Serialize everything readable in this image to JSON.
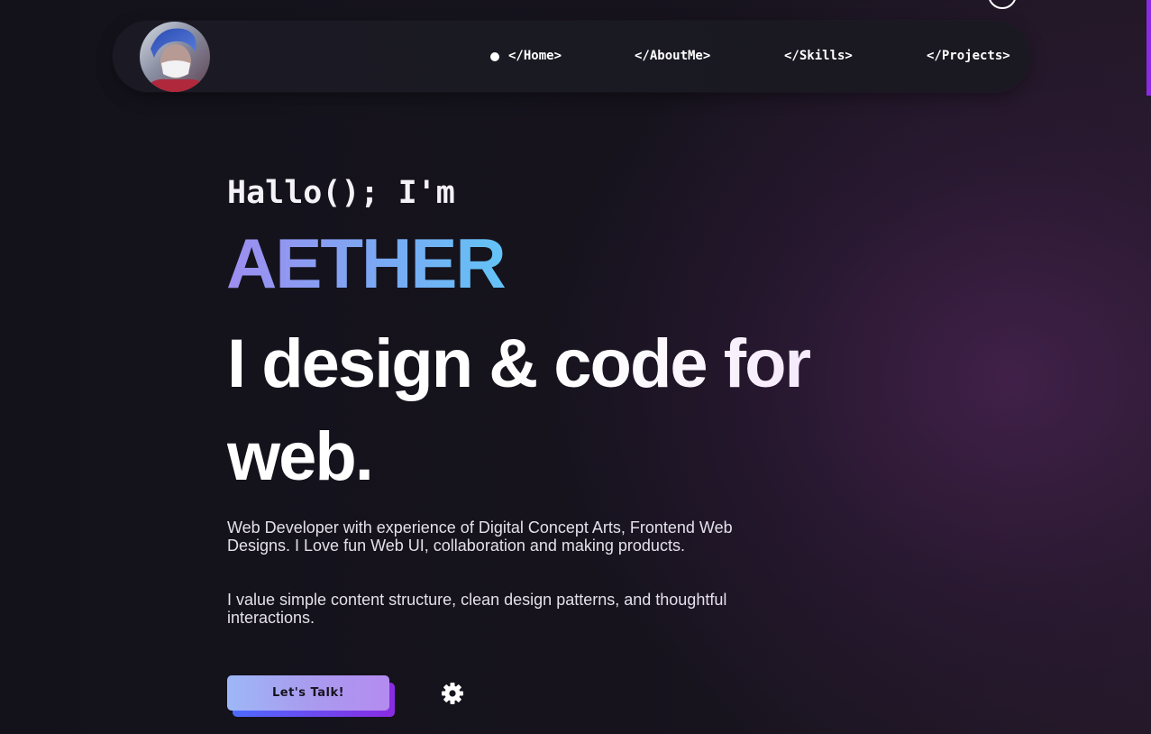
{
  "nav": {
    "links": [
      {
        "label": "</Home>"
      },
      {
        "label": "</AboutMe>"
      },
      {
        "label": "</Skills>"
      },
      {
        "label": "</Projects>"
      }
    ],
    "active_index": 0
  },
  "hero": {
    "greeting": "Hallo(); I'm",
    "name": "AETHER",
    "headline": "I design & code for web.",
    "description_1": "Web Developer with experience of Digital Concept Arts, Frontend Web Designs. I Love fun Web UI, collaboration and making products.",
    "description_2": "I value simple content structure, clean design patterns, and thoughtful interactions.",
    "cta_label": "Let's Talk!"
  },
  "icons": {
    "avatar": "profile-photo",
    "settings": "gear-icon",
    "active_indicator": "dot-icon",
    "top_right": "circle-icon"
  },
  "colors": {
    "background": "#16131d",
    "accent_purple": "#8a2be2",
    "name_gradient_start": "#9e8df0",
    "name_gradient_end": "#63c3f6",
    "button_gradient_start": "#9db7f6",
    "button_gradient_end": "#b48bf0"
  }
}
